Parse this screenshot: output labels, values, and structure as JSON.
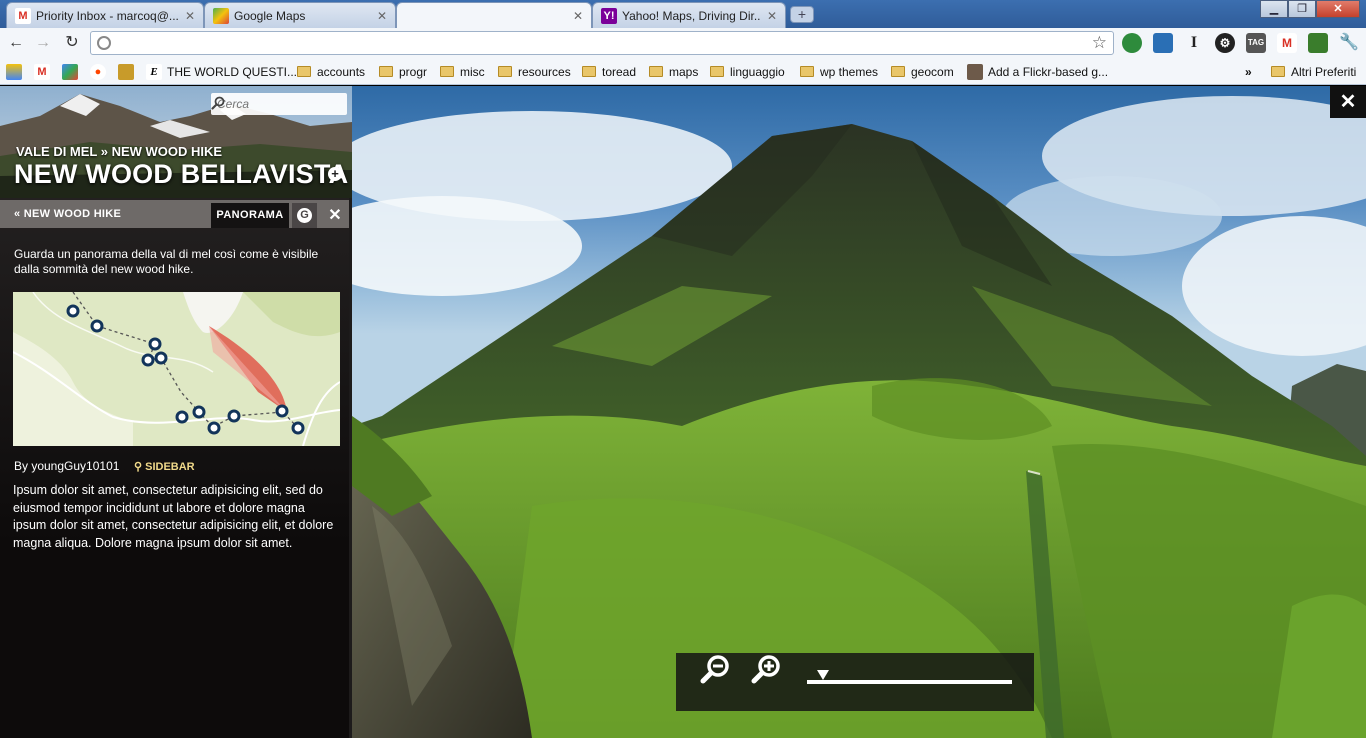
{
  "browser": {
    "tabs": [
      {
        "title": "Priority Inbox - marcoq@...",
        "icon": "gmail-icon",
        "active": false
      },
      {
        "title": "Google Maps",
        "icon": "google-maps-icon",
        "active": false
      },
      {
        "title": "",
        "icon": "blank-page-icon",
        "active": true
      },
      {
        "title": "Yahoo! Maps, Driving Dir...",
        "icon": "yahoo-icon",
        "active": false
      }
    ],
    "address": "",
    "bookmarks": [
      {
        "label": "",
        "type": "picasa"
      },
      {
        "label": "",
        "type": "gmail"
      },
      {
        "label": "",
        "type": "google"
      },
      {
        "label": "",
        "type": "reddit"
      },
      {
        "label": "",
        "type": "misc"
      },
      {
        "label": "THE WORLD QUESTI...",
        "type": "link"
      },
      {
        "label": "accounts",
        "type": "folder"
      },
      {
        "label": "progr",
        "type": "folder"
      },
      {
        "label": "misc",
        "type": "folder"
      },
      {
        "label": "resources",
        "type": "folder"
      },
      {
        "label": "toread",
        "type": "folder"
      },
      {
        "label": "maps",
        "type": "folder"
      },
      {
        "label": "linguaggio",
        "type": "folder"
      },
      {
        "label": "wp themes",
        "type": "folder"
      },
      {
        "label": "geocom",
        "type": "folder"
      },
      {
        "label": "Add a Flickr-based g...",
        "type": "link"
      }
    ],
    "overflow_label": "»",
    "other_bookmarks": "Altri Preferiti"
  },
  "sidebar": {
    "search_placeholder": "Cerca",
    "breadcrumb": "VALE DI MEL » NEW WOOD HIKE",
    "title": "NEW WOOD BELLAVISTA",
    "back_link": "« NEW WOOD HIKE",
    "active_tab": "PANORAMA",
    "intro": "Guarda un panorama della val di mel così come è visibile dalla sommità del new wood hike.",
    "byline": "By youngGuy10101",
    "sidebar_link": "SIDEBAR",
    "body": "Ipsum dolor sit amet, consectetur adipisicing elit, sed do eiusmod tempor incididunt ut labore et dolore magna ipsum dolor sit amet, consectetur adipisicing elit, et dolore magna aliqua. Dolore magna ipsum dolor sit amet."
  },
  "map": {
    "waypoints": 11,
    "view_cone_color": "#e0584a"
  },
  "zoom": {
    "level": 0.08
  },
  "colors": {
    "accent_link": "#f0d98a",
    "sidebar_bg": "#141212",
    "tab_strip": "#6e6a68"
  }
}
